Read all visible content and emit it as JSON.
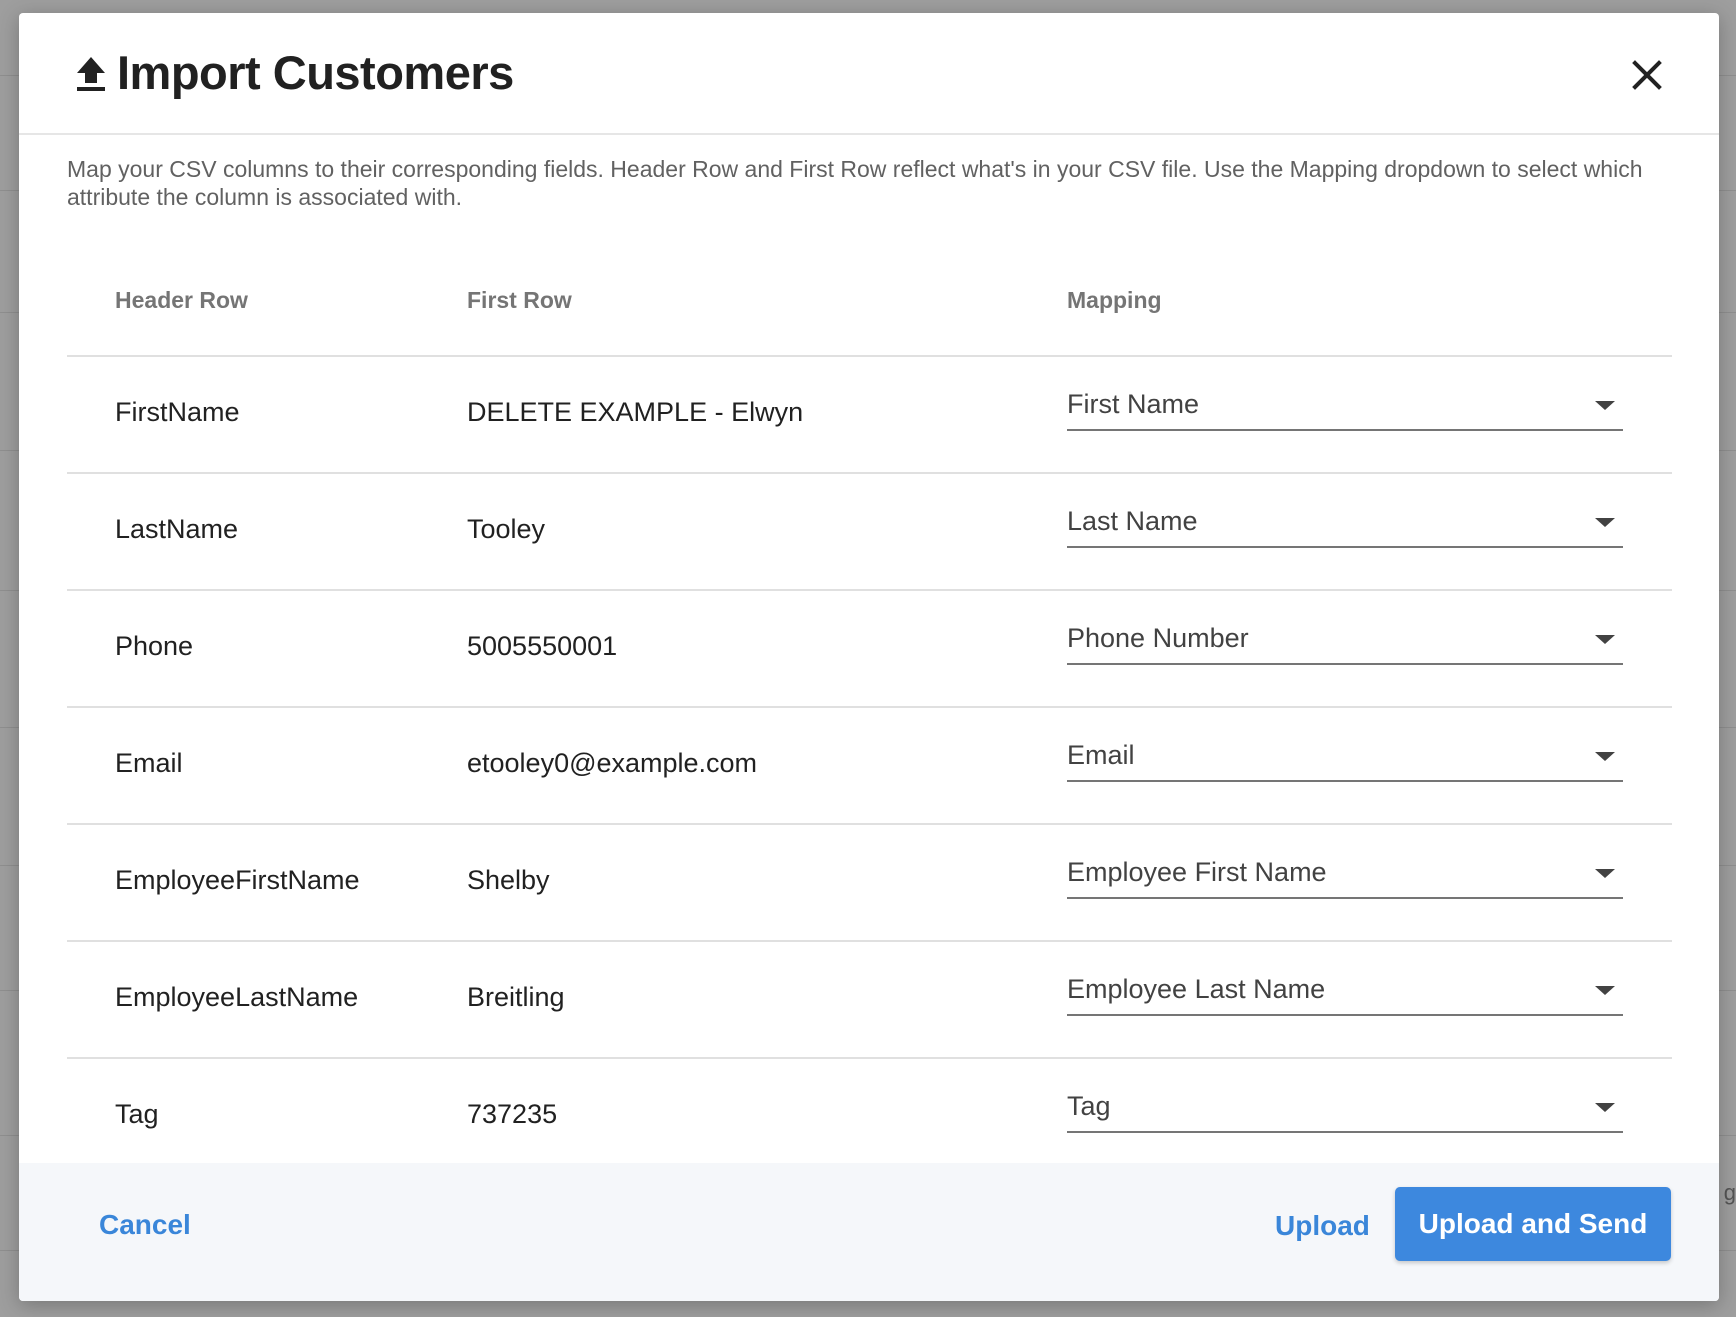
{
  "modal": {
    "title": "Import Customers",
    "description": "Map your CSV columns to their corresponding fields. Header Row and First Row reflect what's in your CSV file. Use the Mapping dropdown to select which attribute the column is associated with."
  },
  "table": {
    "columns": [
      "Header Row",
      "First Row",
      "Mapping"
    ],
    "rows": [
      {
        "header": "FirstName",
        "first": "DELETE EXAMPLE - Elwyn",
        "mapping": "First Name"
      },
      {
        "header": "LastName",
        "first": "Tooley",
        "mapping": "Last Name"
      },
      {
        "header": "Phone",
        "first": "5005550001",
        "mapping": "Phone Number"
      },
      {
        "header": "Email",
        "first": "etooley0@example.com",
        "mapping": "Email"
      },
      {
        "header": "EmployeeFirstName",
        "first": "Shelby",
        "mapping": "Employee First Name"
      },
      {
        "header": "EmployeeLastName",
        "first": "Breitling",
        "mapping": "Employee Last Name"
      },
      {
        "header": "Tag",
        "first": "737235",
        "mapping": "Tag"
      }
    ]
  },
  "footer": {
    "cancel_label": "Cancel",
    "upload_label": "Upload",
    "upload_send_label": "Upload and Send"
  },
  "backdrop": {
    "peek_text": "g"
  },
  "colors": {
    "accent": "#3d88de",
    "link": "#3a86d9",
    "footer_bg": "#f5f7fa"
  },
  "icons": {
    "title_icon": "upload-icon",
    "close": "close-icon",
    "dropdown": "chevron-down-icon"
  }
}
